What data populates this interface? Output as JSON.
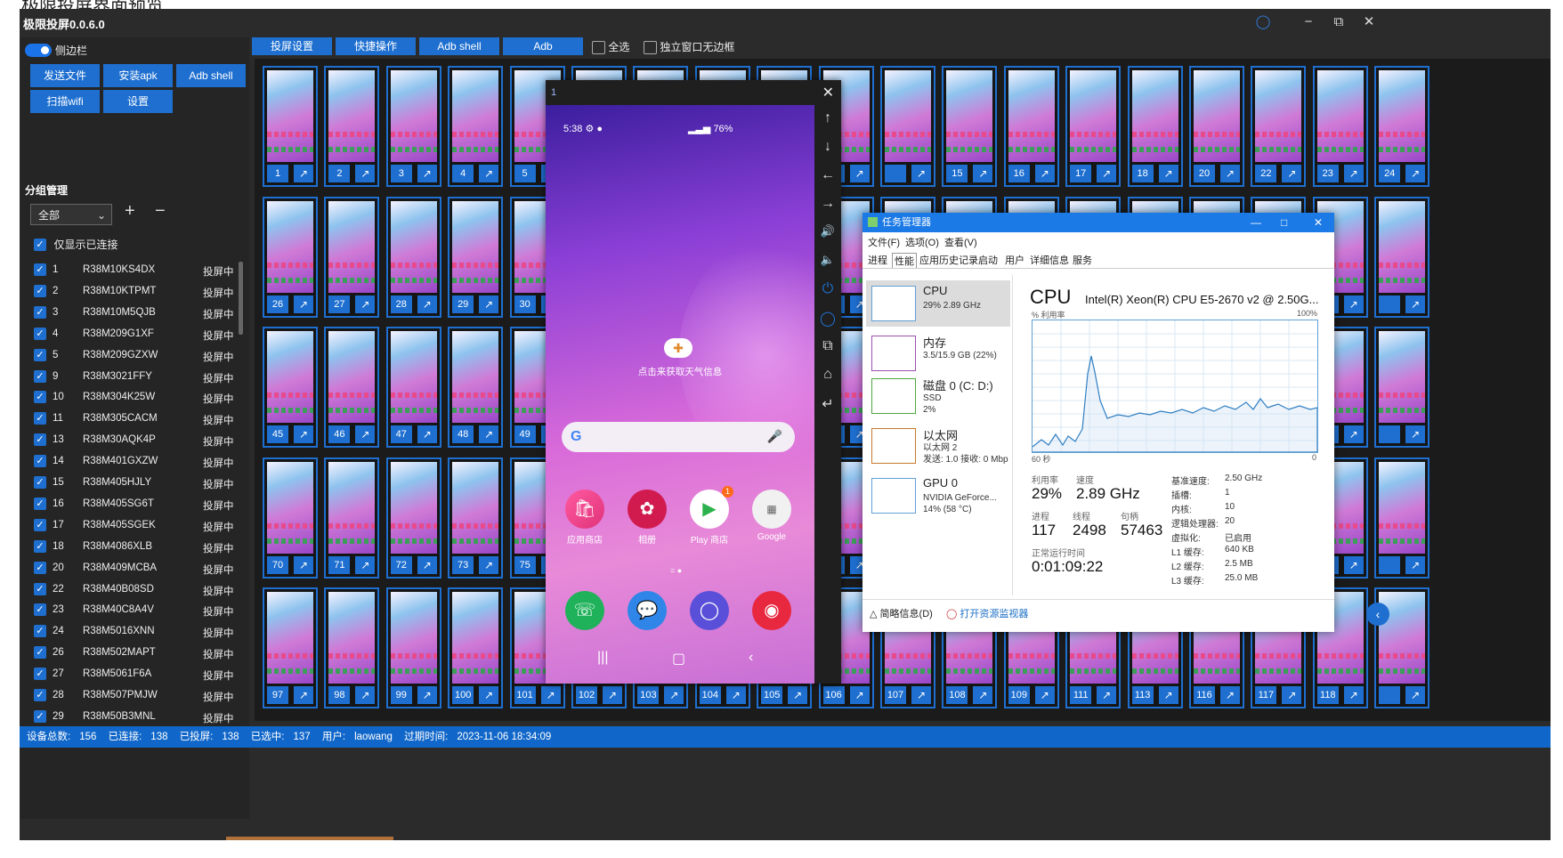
{
  "page_heading": "极限投屏界面预览",
  "app": {
    "title": "极限投屏0.0.6.0"
  },
  "window_controls": {
    "minimize": "−",
    "maximize": "⧉",
    "close": "✕"
  },
  "sidebar": {
    "toggle_label": "侧边栏",
    "buttons": [
      "发送文件",
      "安装apk",
      "Adb shell",
      "扫描wifi",
      "设置"
    ],
    "group_title": "分组管理",
    "group_select": "全部",
    "add": "+",
    "remove": "−",
    "only_connected": "仅显示已连接",
    "devices": [
      {
        "num": "1",
        "serial": "R38M10KS4DX",
        "status": "投屏中"
      },
      {
        "num": "2",
        "serial": "R38M10KTPMT",
        "status": "投屏中"
      },
      {
        "num": "3",
        "serial": "R38M10M5QJB",
        "status": "投屏中"
      },
      {
        "num": "4",
        "serial": "R38M209G1XF",
        "status": "投屏中"
      },
      {
        "num": "5",
        "serial": "R38M209GZXW",
        "status": "投屏中"
      },
      {
        "num": "9",
        "serial": "R38M3021FFY",
        "status": "投屏中"
      },
      {
        "num": "10",
        "serial": "R38M304K25W",
        "status": "投屏中"
      },
      {
        "num": "11",
        "serial": "R38M305CACM",
        "status": "投屏中"
      },
      {
        "num": "13",
        "serial": "R38M30AQK4P",
        "status": "投屏中"
      },
      {
        "num": "14",
        "serial": "R38M401GXZW",
        "status": "投屏中"
      },
      {
        "num": "15",
        "serial": "R38M405HJLY",
        "status": "投屏中"
      },
      {
        "num": "16",
        "serial": "R38M405SG6T",
        "status": "投屏中"
      },
      {
        "num": "17",
        "serial": "R38M405SGEK",
        "status": "投屏中"
      },
      {
        "num": "18",
        "serial": "R38M4086XLB",
        "status": "投屏中"
      },
      {
        "num": "20",
        "serial": "R38M409MCBA",
        "status": "投屏中"
      },
      {
        "num": "22",
        "serial": "R38M40B08SD",
        "status": "投屏中"
      },
      {
        "num": "23",
        "serial": "R38M40C8A4V",
        "status": "投屏中"
      },
      {
        "num": "24",
        "serial": "R38M5016XNN",
        "status": "投屏中"
      },
      {
        "num": "26",
        "serial": "R38M502MAPT",
        "status": "投屏中"
      },
      {
        "num": "27",
        "serial": "R38M5061F6A",
        "status": "投屏中"
      },
      {
        "num": "28",
        "serial": "R38M507PMJW",
        "status": "投屏中"
      },
      {
        "num": "29",
        "serial": "R38M50B3MNL",
        "status": "投屏中"
      }
    ]
  },
  "toolbar": {
    "buttons": [
      "投屏设置",
      "快捷操作",
      "Adb shell",
      "Adb"
    ],
    "select_all": "全选",
    "borderless": "独立窗口无边框"
  },
  "grid": {
    "rows": [
      [
        "1",
        "2",
        "3",
        "4",
        "5",
        "",
        "",
        "",
        "",
        "",
        "",
        "15",
        "16",
        "17",
        "18",
        "20",
        "22",
        "23",
        "24"
      ],
      [
        "26",
        "27",
        "28",
        "29",
        "30",
        "",
        "",
        "",
        "",
        "",
        "",
        "",
        "",
        "",
        "",
        "",
        "",
        "",
        ""
      ],
      [
        "45",
        "46",
        "47",
        "48",
        "49",
        "",
        "",
        "",
        "",
        "",
        "",
        "",
        "",
        "",
        "",
        "",
        "",
        "",
        ""
      ],
      [
        "70",
        "71",
        "72",
        "73",
        "75",
        "",
        "",
        "",
        "",
        "",
        "",
        "",
        "",
        "",
        "",
        "",
        "",
        "",
        ""
      ],
      [
        "97",
        "98",
        "99",
        "100",
        "101",
        "102",
        "103",
        "104",
        "105",
        "106",
        "107",
        "108",
        "109",
        "111",
        "113",
        "116",
        "117",
        "118",
        ""
      ]
    ],
    "open_icon": "external-link-icon"
  },
  "status": {
    "total_label": "设备总数:",
    "total": "156",
    "connected_label": "已连接:",
    "connected": "138",
    "casting_label": "已投屏:",
    "casting": "138",
    "selected_label": "已选中:",
    "selected": "137",
    "user_label": "用户:",
    "user": "laowang",
    "expire_label": "过期时间:",
    "expire": "2023-11-06 18:34:09"
  },
  "phone": {
    "title": "1",
    "time": "5:38",
    "battery": "76%",
    "weather_text": "点击来获取天气信息",
    "apps": [
      "应用商店",
      "相册",
      "Play 商店",
      "Google"
    ],
    "badge": "1",
    "side_icons": [
      "arrow-up-icon",
      "arrow-down-icon",
      "arrow-left-icon",
      "arrow-right-icon",
      "volume-up-icon",
      "volume-down-icon",
      "power-icon",
      "bulb-icon",
      "multiwindow-icon",
      "home-icon",
      "back-icon"
    ]
  },
  "taskmgr": {
    "title": "任务管理器",
    "menu": [
      "文件(F)",
      "选项(O)",
      "查看(V)"
    ],
    "tabs": [
      "进程",
      "性能",
      "应用历史记录",
      "启动",
      "用户",
      "详细信息",
      "服务"
    ],
    "resources": [
      {
        "name": "CPU",
        "sub": "29% 2.89 GHz"
      },
      {
        "name": "内存",
        "sub": "3.5/15.9 GB (22%)"
      },
      {
        "name": "磁盘 0 (C: D:)",
        "sub": "SSD\n2%"
      },
      {
        "name": "以太网",
        "sub": "以太网 2\n发送: 1.0 接收: 0 Mbp"
      },
      {
        "name": "GPU 0",
        "sub": "NVIDIA GeForce...\n14% (58 °C)"
      }
    ],
    "cpu_title": "CPU",
    "cpu_name": "Intel(R) Xeon(R) CPU E5-2670 v2 @ 2.50G...",
    "util_label": "% 利用率",
    "pct100": "100%",
    "secs": "60 秒",
    "zero": "0",
    "stats": {
      "util_l": "利用率",
      "util": "29%",
      "speed_l": "速度",
      "speed": "2.89 GHz",
      "proc_l": "进程",
      "proc": "117",
      "thread_l": "线程",
      "thread": "2498",
      "handle_l": "句柄",
      "handle": "57463",
      "uptime_l": "正常运行时间",
      "uptime": "0:01:09:22"
    },
    "specs": [
      {
        "k": "基准速度:",
        "v": "2.50 GHz"
      },
      {
        "k": "插槽:",
        "v": "1"
      },
      {
        "k": "内核:",
        "v": "10"
      },
      {
        "k": "逻辑处理器:",
        "v": "20"
      },
      {
        "k": "虚拟化:",
        "v": "已启用"
      },
      {
        "k": "L1 缓存:",
        "v": "640 KB"
      },
      {
        "k": "L2 缓存:",
        "v": "2.5 MB"
      },
      {
        "k": "L3 缓存:",
        "v": "25.0 MB"
      }
    ],
    "brief": "简略信息(D)",
    "monitor": "打开资源监视器"
  }
}
